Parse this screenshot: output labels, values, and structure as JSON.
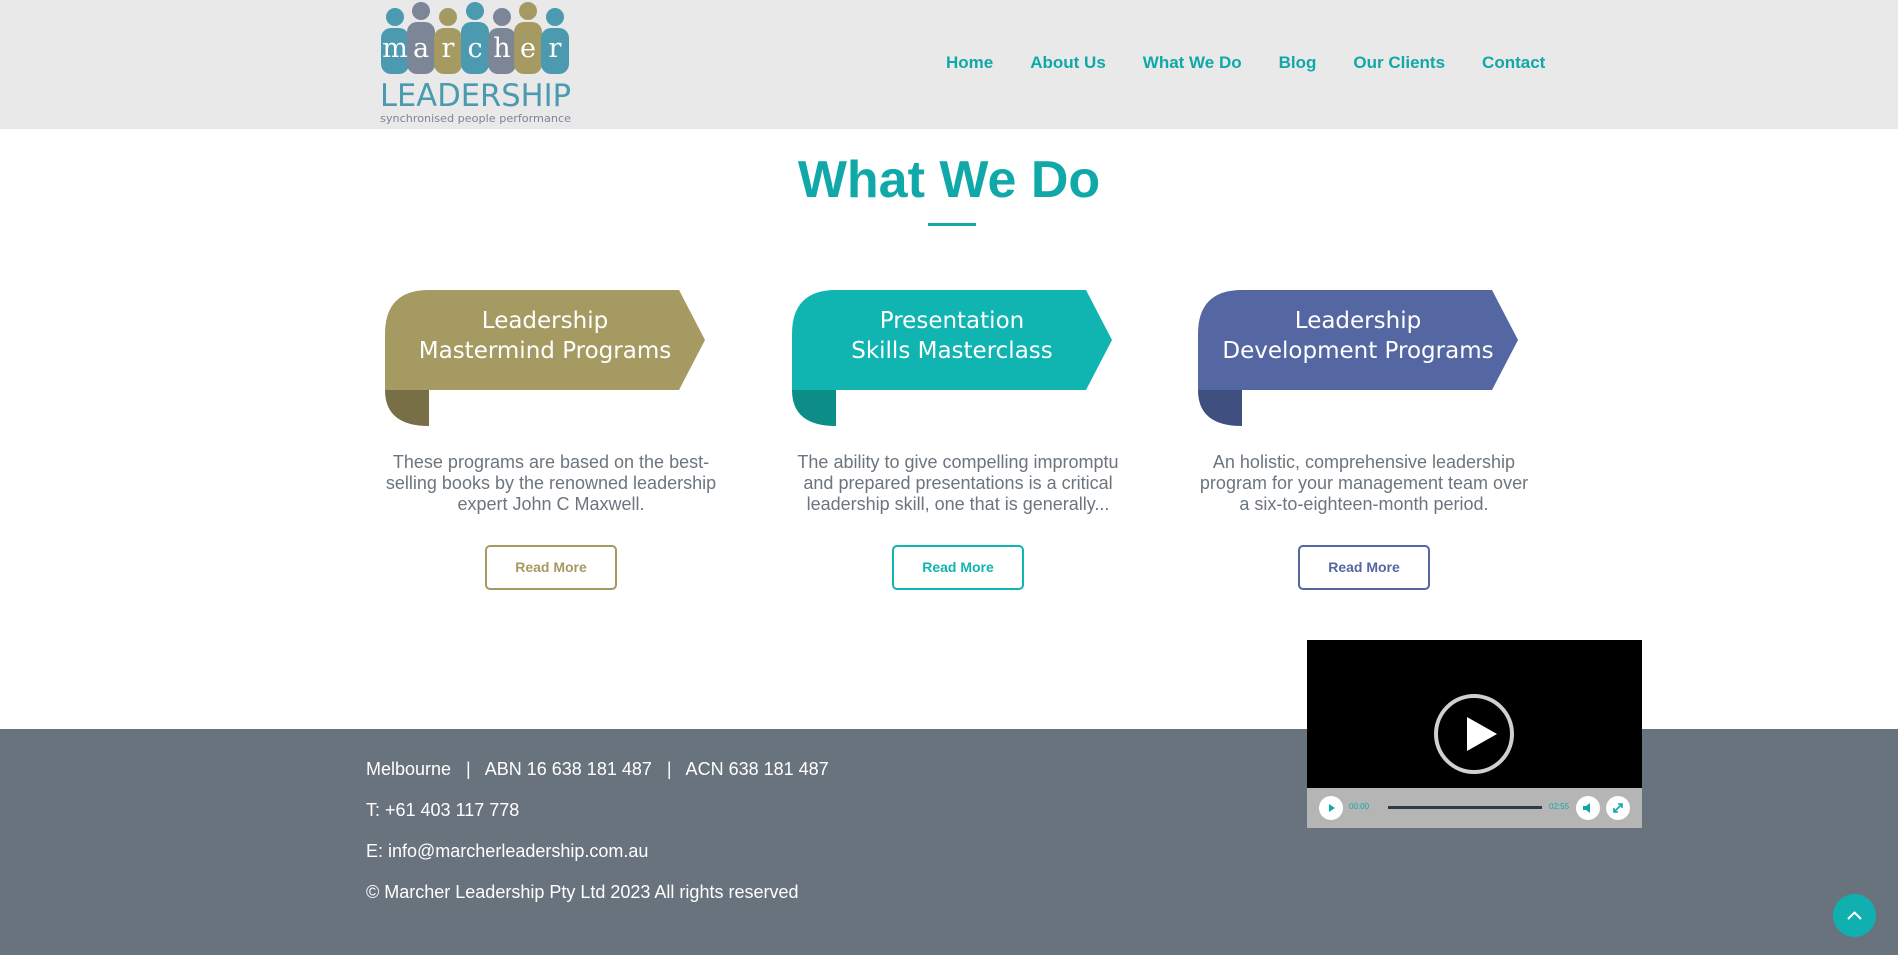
{
  "logo": {
    "letters": [
      "m",
      "a",
      "r",
      "c",
      "h",
      "e",
      "r"
    ],
    "wordmark": "LEADERSHIP",
    "tagline": "synchronised people performance"
  },
  "nav": {
    "items": [
      "Home",
      "About Us",
      "What We Do",
      "Blog",
      "Our Clients",
      "Contact"
    ]
  },
  "section": {
    "title": "What We Do"
  },
  "cards": [
    {
      "title_line1": "Leadership",
      "title_line2": "Mastermind Programs",
      "description": "These programs are based on the best-selling books by the renowned leadership expert John C Maxwell.",
      "button": "Read More",
      "color": "#a59b62",
      "shadow_color": "#786f47"
    },
    {
      "title_line1": "Presentation",
      "title_line2": "Skills Masterclass",
      "description": "The ability to give compelling impromptu and prepared presentations is a critical leadership skill, one that is generally...",
      "button": "Read More",
      "color": "#10b5b1",
      "shadow_color": "#0c8d88"
    },
    {
      "title_line1": "Leadership",
      "title_line2": "Development Programs",
      "description": "An holistic, comprehensive leadership program for your management team over a six-to-eighteen-month period.",
      "button": "Read More",
      "color": "#5467a2",
      "shadow_color": "#3f4f7f"
    }
  ],
  "footer": {
    "line1": "Melbourne   |   ABN 16 638 181 487   |   ACN 638 181 487",
    "phone": "T: +61 403 117 778",
    "email": "E: info@marcherleadership.com.au",
    "copyright": "© Marcher Leadership Pty Ltd 2023 All rights reserved"
  },
  "video": {
    "current_time": "00:00",
    "duration": "02:55"
  },
  "colors": {
    "accent": "#10a8a8",
    "header_bg": "#e9e9e9",
    "footer_bg": "#68737d"
  },
  "icons": {
    "play": "play-icon",
    "mute": "volume-icon",
    "fullscreen": "fullscreen-icon",
    "back_to_top": "chevron-up-icon"
  }
}
